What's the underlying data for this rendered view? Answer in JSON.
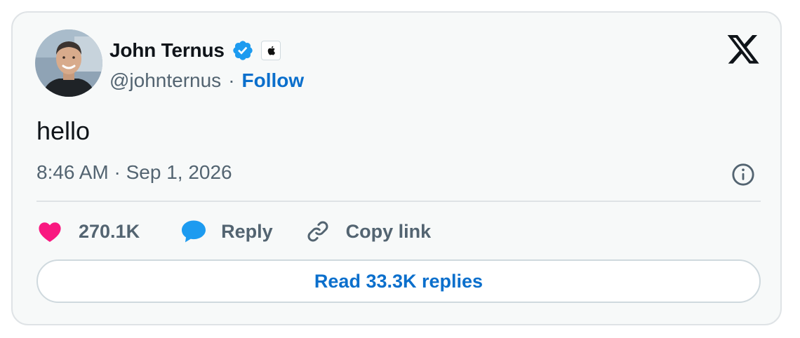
{
  "author": {
    "name": "John Ternus",
    "handle": "@johnternus",
    "separator": "·",
    "follow_label": "Follow",
    "verified_color": "#1d9bf0",
    "avatar_icon": "profile-photo",
    "affiliation_icon": "apple-logo-icon"
  },
  "tweet": {
    "text": "hello",
    "timestamp": "8:46 AM · Sep 1, 2026"
  },
  "actions": {
    "likes_count": "270.1K",
    "reply_label": "Reply",
    "copy_link_label": "Copy link"
  },
  "read_replies_label": "Read 33.3K replies",
  "colors": {
    "like": "#f91880",
    "reply": "#1d9bf0",
    "link": "#0b6fcc",
    "muted": "#536471"
  }
}
